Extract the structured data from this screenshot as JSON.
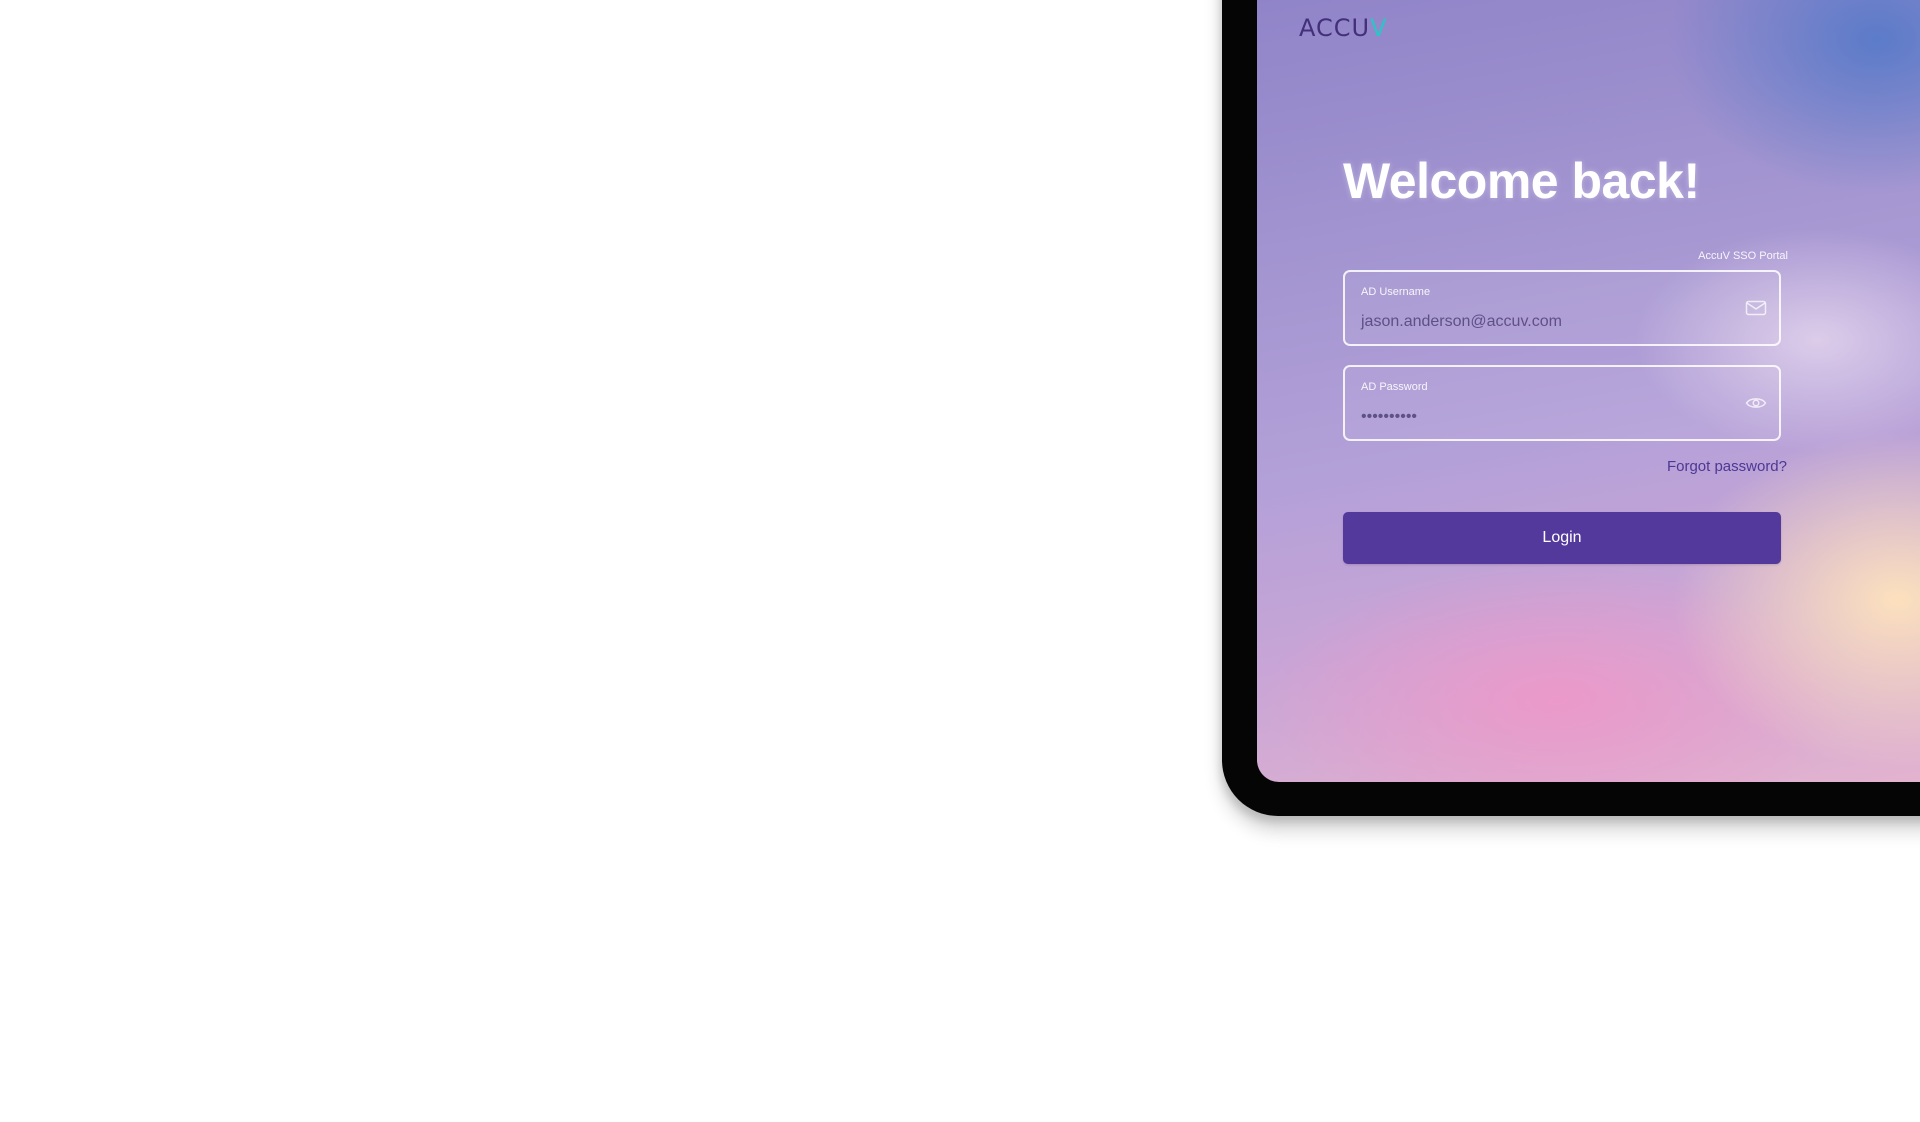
{
  "logo": {
    "prefix": "ACCU",
    "suffix": "V"
  },
  "login": {
    "title": "Welcome back!",
    "portal_label": "AccuV SSO Portal",
    "username": {
      "label": "AD Username",
      "value": "jason.anderson@accuv.com",
      "icon": "mail-icon"
    },
    "password": {
      "label": "AD Password",
      "value": "••••••••••",
      "icon": "eye-icon"
    },
    "forgot_password": "Forgot password?",
    "login_button": "Login"
  },
  "colors": {
    "primary": "#53399c",
    "logo_text": "#43307a",
    "logo_accent": "#2bc5c8",
    "link": "#4c3896"
  }
}
